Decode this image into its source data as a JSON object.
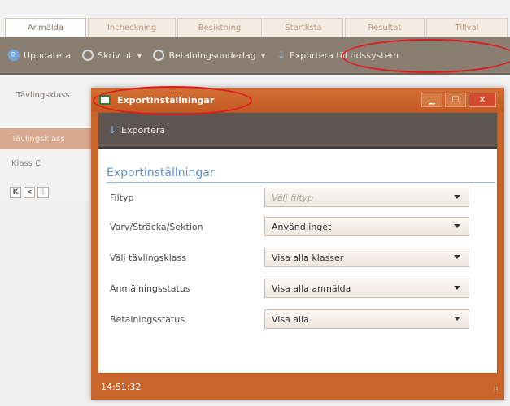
{
  "tabs": [
    "Anmälda",
    "Incheckning",
    "Besiktning",
    "Startlista",
    "Resultat",
    "Tillval"
  ],
  "toolbar": {
    "update": "Uppdatera",
    "print": "Skriv ut",
    "payment": "Betalningsunderlag",
    "export": "Exportera till tidssystem"
  },
  "background": {
    "filter_label": "Tävlingsklass",
    "class_header": "Tävlingsklass",
    "class_row": "Klass C",
    "pager_first": "K",
    "pager_prev": "<",
    "pager_page": "1"
  },
  "dialog": {
    "title": "Exportinställningar",
    "toolbar_export": "Exportera",
    "section_title": "Exportinställningar",
    "fields": [
      {
        "label": "Filtyp",
        "value": "Välj filtyp",
        "placeholder": true
      },
      {
        "label": "Varv/Sträcka/Sektion",
        "value": "Använd inget",
        "placeholder": false
      },
      {
        "label": "Välj tävlingsklass",
        "value": "Visa alla klasser",
        "placeholder": false
      },
      {
        "label": "Anmälningsstatus",
        "value": "Visa alla anmälda",
        "placeholder": false
      },
      {
        "label": "Betalningsstatus",
        "value": "Visa alla",
        "placeholder": false
      }
    ],
    "status_time": "14:51:32"
  },
  "colors": {
    "accent": "#c9642a",
    "toolbar_bg": "#8a7e73",
    "section_title": "#5e8fc7",
    "annotation": "#e01a1a"
  }
}
